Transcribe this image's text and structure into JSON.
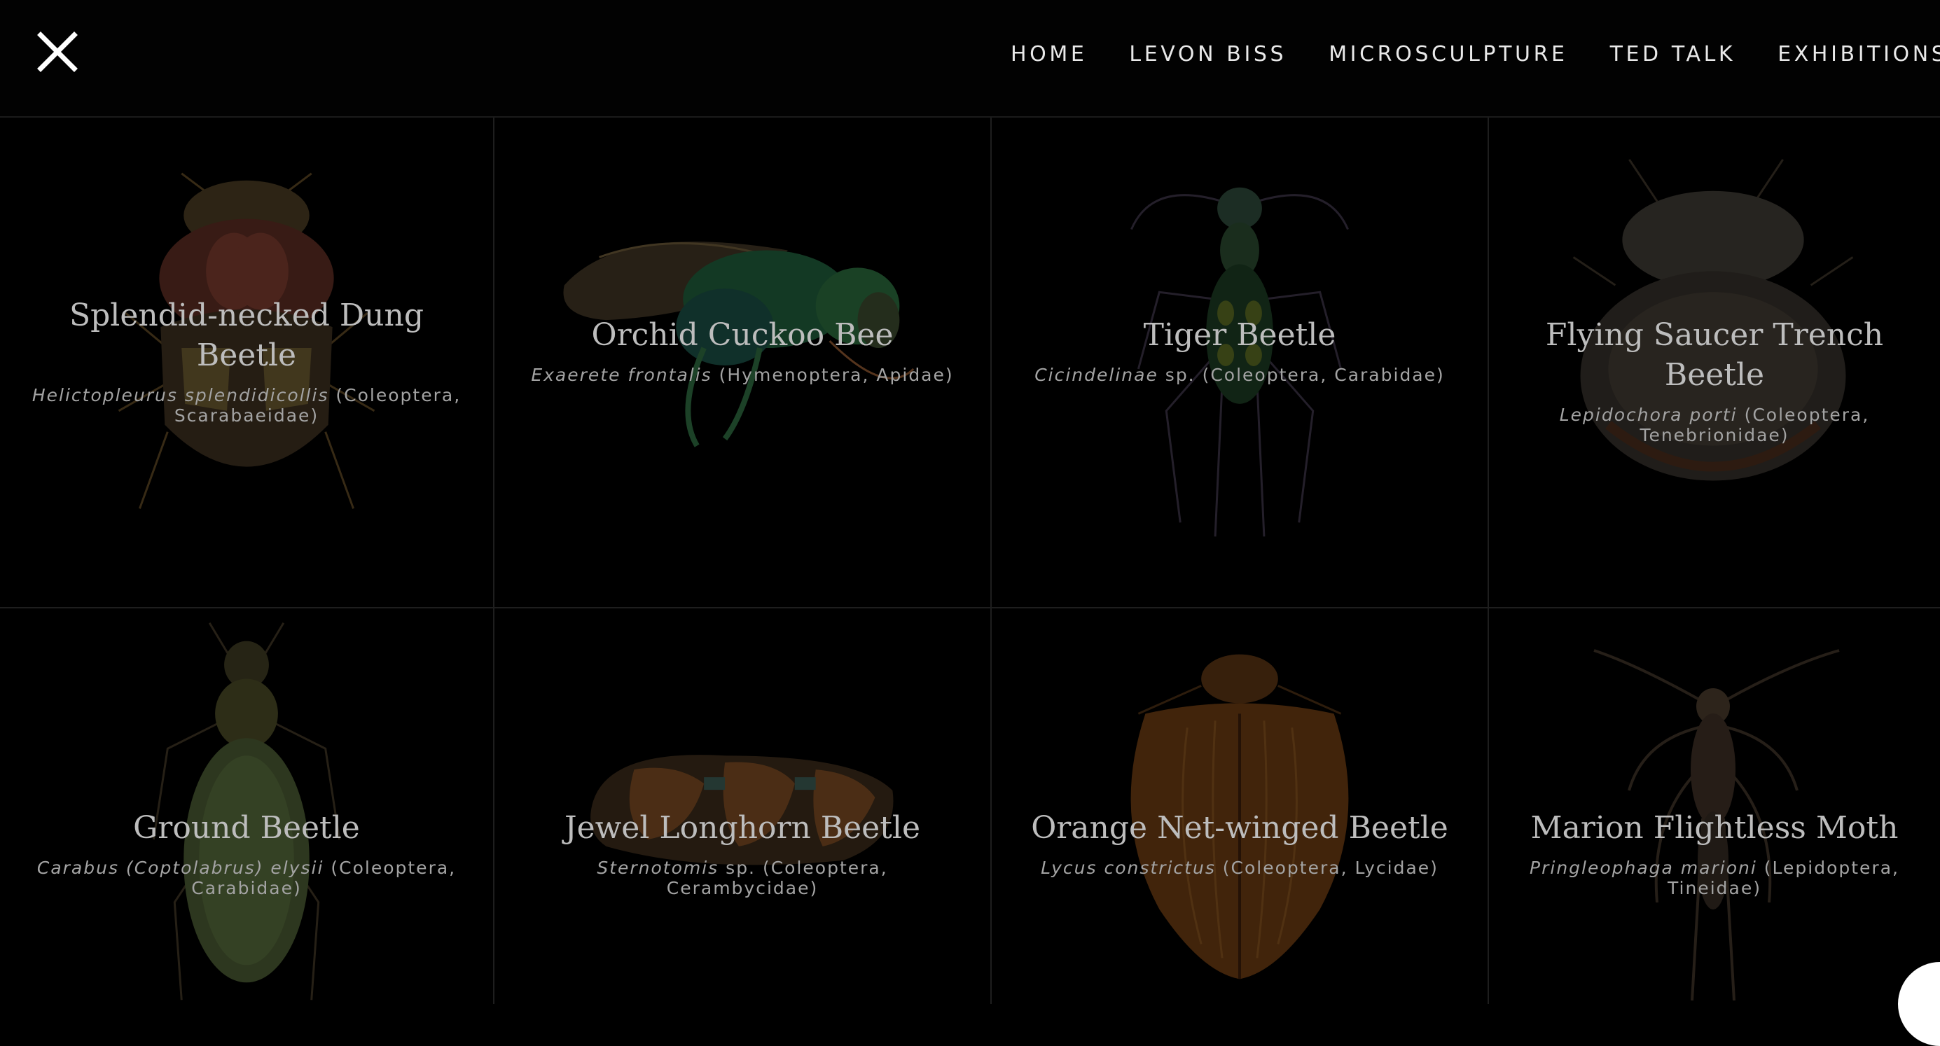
{
  "nav": {
    "close_icon": "close-icon",
    "items": [
      "HOME",
      "LEVON BISS",
      "MICROSCULPTURE",
      "TED TALK",
      "EXHIBITIONS"
    ]
  },
  "colors": {
    "background": "#000000",
    "nav_text": "#e9e9e9",
    "caption_title": "#bdbdbd",
    "caption_sub": "#a3a3a3"
  },
  "tiles": [
    {
      "title": "Splendid-necked Dung Beetle",
      "latin": "Helictopleurus splendidicollis",
      "taxon": " (Coleoptera, Scarabaeidae)",
      "image": "dung-beetle"
    },
    {
      "title": "Orchid Cuckoo Bee",
      "latin": "Exaerete frontalis",
      "taxon": " (Hymenoptera, Apidae)",
      "image": "cuckoo-bee"
    },
    {
      "title": "Tiger Beetle",
      "latin": "Cicindelinae",
      "taxon": " sp. (Coleoptera, Carabidae)",
      "image": "tiger-beetle"
    },
    {
      "title": "Flying Saucer Trench Beetle",
      "latin": "Lepidochora porti",
      "taxon": " (Coleoptera, Tenebrionidae)",
      "image": "trench-beetle"
    },
    {
      "title": "Ground Beetle",
      "latin": "Carabus (Coptolabrus) elysii",
      "taxon": " (Coleoptera, Carabidae)",
      "image": "ground-beetle"
    },
    {
      "title": "Jewel Longhorn Beetle",
      "latin": "Sternotomis",
      "taxon": " sp. (Coleoptera, Cerambycidae)",
      "image": "longhorn-beetle"
    },
    {
      "title": "Orange Net-winged Beetle",
      "latin": "Lycus constrictus",
      "taxon": " (Coleoptera, Lycidae)",
      "image": "net-winged-beetle"
    },
    {
      "title": "Marion Flightless Moth",
      "latin": "Pringleophaga marioni",
      "taxon": " (Lepidoptera, Tineidae)",
      "image": "flightless-moth"
    }
  ]
}
